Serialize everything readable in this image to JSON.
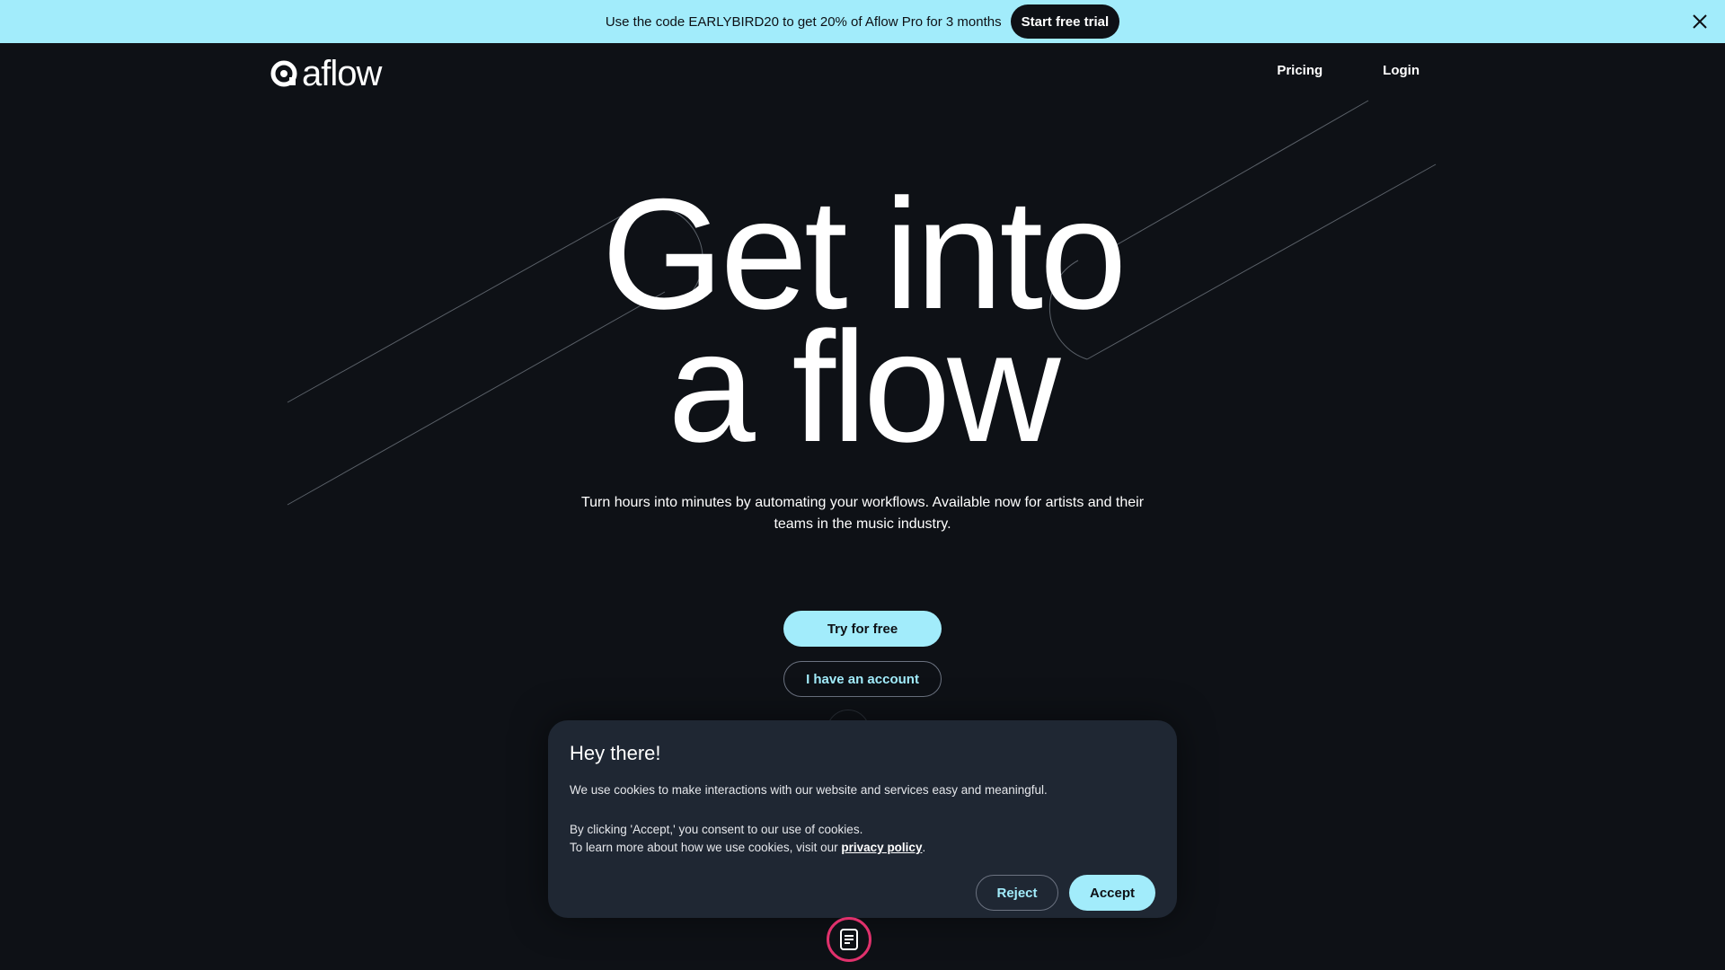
{
  "banner": {
    "text": "Use the code EARLYBIRD20 to get 20% of Aflow Pro for 3 months",
    "cta_label": "Start free trial",
    "close_icon": "close-icon"
  },
  "header": {
    "logo_text": "aflow",
    "nav": [
      {
        "label": "Pricing"
      },
      {
        "label": "Login"
      }
    ]
  },
  "hero": {
    "title_line1": "Get into",
    "title_line2": "a flow",
    "subtitle": "Turn hours into minutes by automating your workflows. Available now for artists and their teams in the music industry.",
    "primary_cta": "Try for free",
    "secondary_cta": "I have an account"
  },
  "cookie": {
    "title": "Hey there!",
    "line1": "We use cookies to make interactions with our website and services easy and meaningful.",
    "line2": "By clicking 'Accept,' you consent to our use of cookies.",
    "line3_prefix": "To learn more about how we use cookies, visit our ",
    "line3_link": "privacy policy",
    "line3_suffix": ".",
    "reject_label": "Reject",
    "accept_label": "Accept"
  },
  "colors": {
    "accent": "#a2ecfb",
    "background": "#0e1116",
    "modal": "#1f2733",
    "fab_ring": "#e0316c"
  }
}
